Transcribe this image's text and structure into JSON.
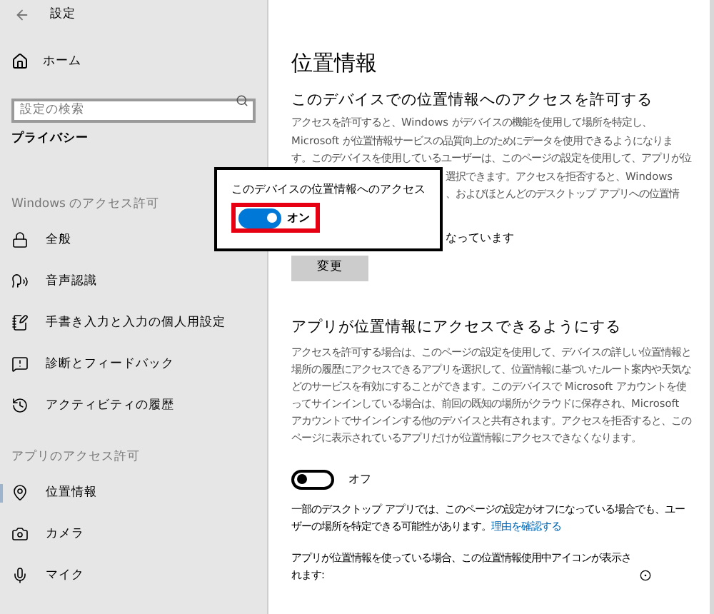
{
  "window": {
    "title": "設定"
  },
  "sidebar": {
    "home": "ホーム",
    "search": {
      "placeholder": "設定の検索"
    },
    "category": "プライバシー",
    "groups": [
      {
        "heading": "Windows のアクセス許可",
        "items": [
          {
            "label": "全般",
            "kind": "lock",
            "selected": false
          },
          {
            "label": "音声認識",
            "kind": "speech",
            "selected": false
          },
          {
            "label": "手書き入力と入力の個人用設定",
            "kind": "notebook",
            "selected": false
          },
          {
            "label": "診断とフィードバック",
            "kind": "feedback",
            "selected": false
          },
          {
            "label": "アクティビティの履歴",
            "kind": "history",
            "selected": false
          }
        ]
      },
      {
        "heading": "アプリのアクセス許可",
        "items": [
          {
            "label": "位置情報",
            "kind": "location",
            "selected": true
          },
          {
            "label": "カメラ",
            "kind": "camera",
            "selected": false
          },
          {
            "label": "マイク",
            "kind": "mic",
            "selected": false
          }
        ]
      }
    ]
  },
  "page": {
    "title": "位置情報",
    "device_section": {
      "heading": "このデバイスでの位置情報へのアクセスを許可する",
      "description_lines": [
        {
          "text": "アクセスを許可すると、Windows がデバイスの機能を使用して場所を特定し、",
          "kind": "full"
        },
        {
          "text": "Microsoft が位置情報サービスの品質向上のためにデータを使用できるようになりま",
          "kind": "full"
        },
        {
          "text": "す。このデバイスを使用しているユーザーは、このページの設定を使用して、アプリが位",
          "kind": "full"
        },
        {
          "text": "選択できます。アクセスを拒否すると、Windows",
          "kind": "covered"
        },
        {
          "text": "、およびほとんどのデスクトップ アプリへの位置情",
          "kind": "covered"
        }
      ],
      "status_text": "なっています",
      "button": "変更"
    },
    "popup": {
      "label": "このデバイスの位置情報へのアクセス",
      "highlighted": true,
      "toggle": {
        "on": true,
        "state_text": "オン"
      }
    },
    "apps_section": {
      "heading": "アプリが位置情報にアクセスできるようにする",
      "description": "アクセスを許可する場合は、このページの設定を使用して、デバイスの詳しい位置情報と場所の履歴にアクセスできるアプリを選択して、位置情報に基づいたルート案内や天気などのサービスを有効にすることができます。このデバイスで Microsoft アカウントを使ってサインインしている場合は、前回の既知の場所がクラウドに保存され、Microsoft アカウントでサインインする他のデバイスと共有されます。アクセスを拒否すると、このページに表示されているアプリだけが位置情報にアクセスできなくなります。",
      "toggle": {
        "on": false,
        "state_text": "オフ"
      },
      "note": "一部のデスクトップ アプリでは、このページの設定がオフになっている場合でも、ユーザーの場所を特定できる可能性があります。",
      "note_link": "理由を確認する",
      "icon_note": "アプリが位置情報を使っている場合、この位置情報使用中アイコンが表示されます:"
    }
  }
}
